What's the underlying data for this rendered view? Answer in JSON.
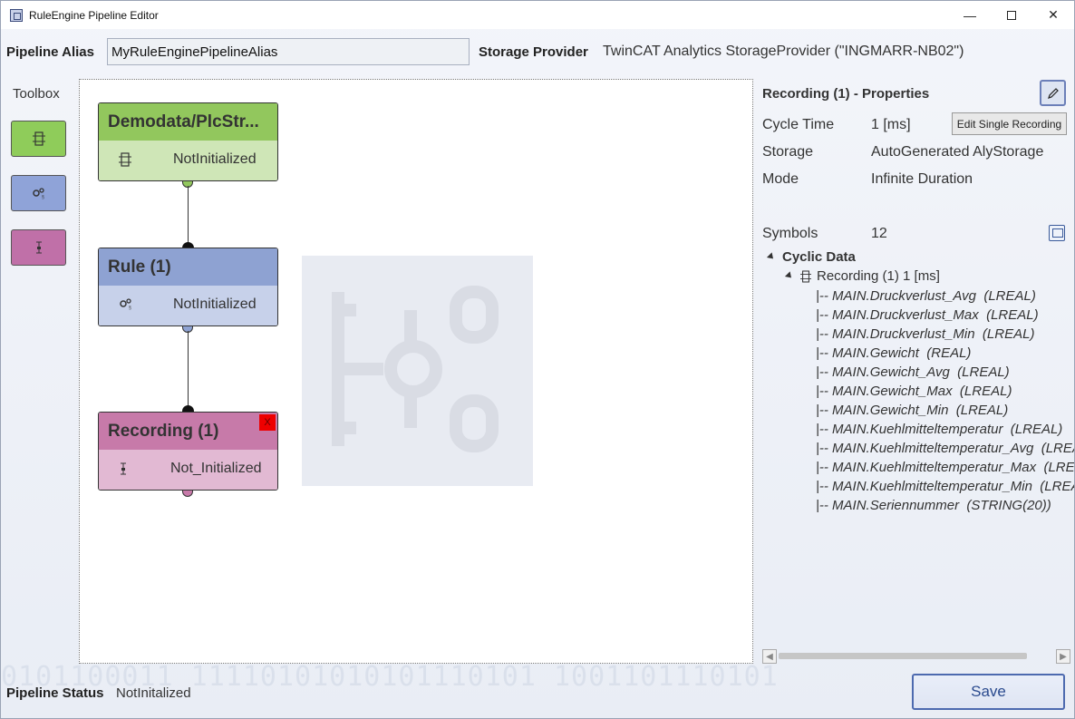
{
  "window": {
    "title": "RuleEngine Pipeline Editor"
  },
  "header": {
    "alias_label": "Pipeline Alias",
    "alias_value": "MyRuleEnginePipelineAlias",
    "provider_label": "Storage Provider",
    "provider_value": "TwinCAT Analytics StorageProvider (\"INGMARR-NB02\")"
  },
  "toolbox": {
    "label": "Toolbox",
    "items": [
      {
        "icon": "data-source-icon",
        "color": "#8fcc5a"
      },
      {
        "icon": "rule-gears-icon",
        "color": "#8fa3d8"
      },
      {
        "icon": "recording-icon",
        "color": "#c070a8"
      }
    ]
  },
  "canvas": {
    "nodes": [
      {
        "title": "Demodata/PlcStr...",
        "status": "NotInitialized",
        "color": "#92c75d"
      },
      {
        "title": "Rule (1)",
        "status": "NotInitialized",
        "color": "#8ea2d2"
      },
      {
        "title": "Recording (1)",
        "status": "Not_Initialized",
        "color": "#c77aa9",
        "delete_label": "X"
      }
    ]
  },
  "properties": {
    "title": "Recording (1) - Properties",
    "tooltip": "Edit Single Recording",
    "rows": [
      {
        "label": "Cycle Time",
        "value": "1 [ms]"
      },
      {
        "label": "Storage",
        "value": "AutoGenerated AlyStorage"
      },
      {
        "label": "Mode",
        "value": "Infinite Duration"
      },
      {
        "label": "Symbols",
        "value": "12"
      }
    ],
    "tree": {
      "root": "Cyclic Data",
      "recording": "Recording (1) 1 [ms]",
      "symbols": [
        "|-- MAIN.Druckverlust_Avg  (LREAL)",
        "|-- MAIN.Druckverlust_Max  (LREAL)",
        "|-- MAIN.Druckverlust_Min  (LREAL)",
        "|-- MAIN.Gewicht  (REAL)",
        "|-- MAIN.Gewicht_Avg  (LREAL)",
        "|-- MAIN.Gewicht_Max  (LREAL)",
        "|-- MAIN.Gewicht_Min  (LREAL)",
        "|-- MAIN.Kuehlmitteltemperatur  (LREAL)",
        "|-- MAIN.Kuehlmitteltemperatur_Avg  (LREAL)",
        "|-- MAIN.Kuehlmitteltemperatur_Max  (LREAL)",
        "|-- MAIN.Kuehlmitteltemperatur_Min  (LREAL)",
        "|-- MAIN.Seriennummer  (STRING(20))"
      ]
    }
  },
  "footer": {
    "status_label": "Pipeline Status",
    "status_value": "NotInitalized",
    "save_label": "Save"
  }
}
